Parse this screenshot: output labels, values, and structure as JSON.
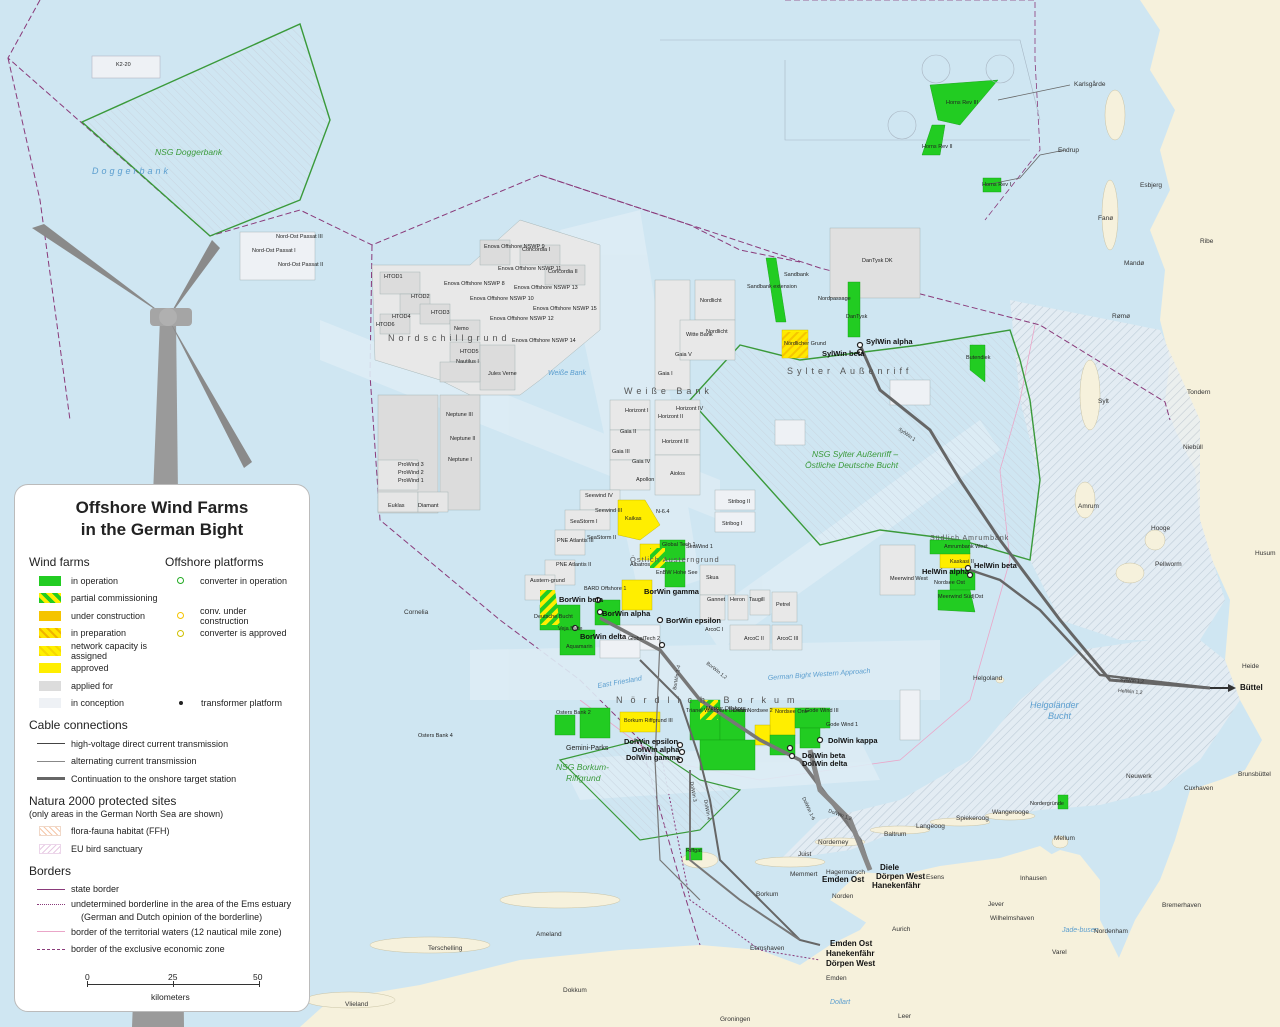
{
  "legend": {
    "title_line1": "Offshore Wind Farms",
    "title_line2": "in the German Bight",
    "wind_farms_heading": "Wind farms",
    "platforms_heading": "Offshore platforms",
    "farm_items": [
      {
        "label": "in operation",
        "color": "#22cc22"
      },
      {
        "label": "partial commissioning",
        "color": "#88cc22"
      },
      {
        "label": "under construction",
        "color": "#f5c400"
      },
      {
        "label": "in preparation",
        "color": "#f5d000"
      },
      {
        "label": "network capacity is assigned",
        "color": "#fff000"
      },
      {
        "label": "approved",
        "color": "#ffee00"
      },
      {
        "label": "applied for",
        "color": "#dcdcdc"
      },
      {
        "label": "in conception",
        "color": "#eef1f5"
      }
    ],
    "platform_items": [
      {
        "label": "converter in operation",
        "color": "#22aa22"
      },
      {
        "label": "conv. under construction",
        "color": "#f5c400"
      },
      {
        "label": "converter is approved",
        "color": "#eedd00"
      },
      {
        "label": "transformer platform",
        "color": "#222222"
      }
    ],
    "cable_heading": "Cable connections",
    "cable_items": [
      {
        "label": "high-voltage direct current transmission"
      },
      {
        "label": "alternating current transmission"
      },
      {
        "label": "Continuation to the onshore target station"
      }
    ],
    "natura_heading": "Natura 2000 protected sites",
    "natura_note": "(only areas in the German North Sea are shown)",
    "natura_items": [
      {
        "label": "flora-fauna habitat (FFH)"
      },
      {
        "label": "EU bird sanctuary"
      }
    ],
    "borders_heading": "Borders",
    "border_items": [
      {
        "label": "state border"
      },
      {
        "label": "undetermined borderline in the area of the Ems estuary"
      },
      {
        "label": "(German and Dutch opinion of the borderline)"
      },
      {
        "label": "border of the territorial waters (12 nautical mile zone)"
      },
      {
        "label": "border of the exclusive economic zone"
      }
    ],
    "scale": {
      "ticks": [
        "0",
        "25",
        "50"
      ],
      "unit": "kilometers"
    }
  },
  "map": {
    "colors": {
      "sea": "#cfe6f2",
      "land": "#f6f1dc",
      "operation": "#22cc22",
      "approved": "#ffee00",
      "applied": "#dcdcdc",
      "nsg": "#3a9a3a",
      "eez": "#8a3a7a"
    },
    "areas": [
      {
        "id": "doggerbank-nsg",
        "text": "NSG Doggerbank"
      },
      {
        "id": "doggerbank",
        "text": "Doggerbank"
      },
      {
        "id": "nordschillgrund",
        "text": "Nordschillgrund"
      },
      {
        "id": "weisse-bank",
        "text": "Weiße Bank"
      },
      {
        "id": "weisse-bank-water",
        "text": "Weiße Bank"
      },
      {
        "id": "sylter-aussenriff",
        "text": "Sylter Außenriff"
      },
      {
        "id": "nsg-sylter-1",
        "text": "NSG Sylter Außenriff –"
      },
      {
        "id": "nsg-sylter-2",
        "text": "Östliche Deutsche Bucht"
      },
      {
        "id": "oestlich-austerngrund",
        "text": "Östlich Austerngrund"
      },
      {
        "id": "suedlich-amrumbank",
        "text": "Südlich Amrumbank"
      },
      {
        "id": "noerdlich-borkum",
        "text": "Nördlich Borkum"
      },
      {
        "id": "nsg-borkum-1",
        "text": "NSG Borkum-"
      },
      {
        "id": "nsg-borkum-2",
        "text": "Riffgrund"
      },
      {
        "id": "helgolaender-bucht-1",
        "text": "Helgoländer"
      },
      {
        "id": "helgolaender-bucht-2",
        "text": "Bucht"
      },
      {
        "id": "german-bight-western-approach",
        "text": "German Bight Western Approach"
      },
      {
        "id": "east-friesland",
        "text": "East Friesland"
      },
      {
        "id": "jadebusen",
        "text": "Jade-busen"
      }
    ],
    "farms_small": [
      {
        "id": "k2-20",
        "text": "K2-20"
      },
      {
        "id": "nordost-passat-3",
        "text": "Nord-Ost Passat III"
      },
      {
        "id": "nordost-passat-1",
        "text": "Nord-Ost Passat I"
      },
      {
        "id": "nordost-passat-2",
        "text": "Nord-Ost Passat II"
      },
      {
        "id": "htod1",
        "text": "HTOD1"
      },
      {
        "id": "htod2",
        "text": "HTOD2"
      },
      {
        "id": "htod3",
        "text": "HTOD3"
      },
      {
        "id": "htod4",
        "text": "HTOD4"
      },
      {
        "id": "htod5",
        "text": "HTOD5"
      },
      {
        "id": "htod6",
        "text": "HTOD6"
      },
      {
        "id": "nautilus-1",
        "text": "Nautilus I"
      },
      {
        "id": "jules-verne",
        "text": "Jules Verne"
      },
      {
        "id": "nemo",
        "text": "Nemo"
      },
      {
        "id": "concordia-1",
        "text": "Concordia I"
      },
      {
        "id": "concordia-2",
        "text": "Concordia II"
      },
      {
        "id": "enova-9",
        "text": "Enova Offshore NSWP 9"
      },
      {
        "id": "enova-8",
        "text": "Enova Offshore NSWP 8"
      },
      {
        "id": "enova-10",
        "text": "Enova Offshore NSWP 10"
      },
      {
        "id": "enova-11",
        "text": "Enova Offshore NSWP 11"
      },
      {
        "id": "enova-12",
        "text": "Enova Offshore NSWP 12"
      },
      {
        "id": "enova-13",
        "text": "Enova Offshore NSWP 13"
      },
      {
        "id": "enova-14",
        "text": "Enova Offshore NSWP 14"
      },
      {
        "id": "enova-15",
        "text": "Enova Offshore NSWP 15"
      },
      {
        "id": "neptune-3",
        "text": "Neptune III"
      },
      {
        "id": "neptune-2",
        "text": "Neptune II"
      },
      {
        "id": "neptune-1",
        "text": "Neptune I"
      },
      {
        "id": "prowind-3",
        "text": "ProWind 3"
      },
      {
        "id": "prowind-2",
        "text": "ProWind 2"
      },
      {
        "id": "prowind-1",
        "text": "ProWind 1"
      },
      {
        "id": "euklas",
        "text": "Euklas"
      },
      {
        "id": "diamant",
        "text": "Diamant"
      },
      {
        "id": "nordlicht",
        "text": "Nordlicht"
      },
      {
        "id": "nordlicht2",
        "text": "Nordlicht"
      },
      {
        "id": "witte-bank",
        "text": "Witte Bank"
      },
      {
        "id": "gaia-5",
        "text": "Gaia V"
      },
      {
        "id": "gaia-1",
        "text": "Gaia I"
      },
      {
        "id": "horizont-1",
        "text": "Horizont I"
      },
      {
        "id": "horizont-4",
        "text": "Horizont IV"
      },
      {
        "id": "horizont-2",
        "text": "Horizont II"
      },
      {
        "id": "horizont-3",
        "text": "Horizont III"
      },
      {
        "id": "gaia-2",
        "text": "Gaia II"
      },
      {
        "id": "gaia-3",
        "text": "Gaia III"
      },
      {
        "id": "gaia-4",
        "text": "Gaia IV"
      },
      {
        "id": "apollon",
        "text": "Apollon"
      },
      {
        "id": "aiolos",
        "text": "Aiolos"
      },
      {
        "id": "seewind-4",
        "text": "Seewind IV"
      },
      {
        "id": "seewind-3",
        "text": "Seewind III"
      },
      {
        "id": "seastorm-1",
        "text": "SeaStorm I"
      },
      {
        "id": "seastorm-2",
        "text": "SeaStorm II"
      },
      {
        "id": "pne-3",
        "text": "PNE Atlantis III"
      },
      {
        "id": "pne-2",
        "text": "PNE Atlantis II"
      },
      {
        "id": "austerngrund",
        "text": "Austern-grund"
      },
      {
        "id": "kaikas",
        "text": "Kaikas"
      },
      {
        "id": "n64",
        "text": "N-6.4"
      },
      {
        "id": "stribog-2",
        "text": "Stribog II"
      },
      {
        "id": "stribog-1",
        "text": "Stribog I"
      },
      {
        "id": "skua",
        "text": "Skua"
      },
      {
        "id": "gannet",
        "text": "Gannet"
      },
      {
        "id": "heron",
        "text": "Heron"
      },
      {
        "id": "tausgill",
        "text": "Taugill"
      },
      {
        "id": "petrel",
        "text": "Petrel"
      },
      {
        "id": "arcoc1",
        "text": "ArcoC I"
      },
      {
        "id": "arcoc2",
        "text": "ArcoC II"
      },
      {
        "id": "arcoc3",
        "text": "ArcoC III"
      },
      {
        "id": "sandbank",
        "text": "Sandbank"
      },
      {
        "id": "sandbank-ext",
        "text": "Sandbank extension"
      },
      {
        "id": "nordpassage",
        "text": "Nordpassage"
      },
      {
        "id": "dantysk",
        "text": "DanTysk"
      },
      {
        "id": "dantysk-dk",
        "text": "DanTysk DK"
      },
      {
        "id": "noerdlicher-grund",
        "text": "Nördlicher Grund"
      },
      {
        "id": "butendiek",
        "text": "Butendiek"
      },
      {
        "id": "horns-rev-3",
        "text": "Horns Rev III"
      },
      {
        "id": "horns-rev-2",
        "text": "Horns Rev II"
      },
      {
        "id": "horns-rev-1",
        "text": "Horns Rev I"
      },
      {
        "id": "amrumbank-west",
        "text": "Amrumbank West"
      },
      {
        "id": "kaskasi",
        "text": "Kaskasi II"
      },
      {
        "id": "nordsee-ost",
        "text": "Nordsee Ost"
      },
      {
        "id": "meerwind",
        "text": "Meerwind Süd|Ost"
      },
      {
        "id": "meerwind-west",
        "text": "Meerwind West"
      },
      {
        "id": "deutsche-bucht",
        "text": "Deutsche Bucht"
      },
      {
        "id": "veja-mate",
        "text": "Veja Mate"
      },
      {
        "id": "bard",
        "text": "BARD Offshore 1"
      },
      {
        "id": "global-tech-1",
        "text": "Global Tech 1"
      },
      {
        "id": "seawind-1",
        "text": "SeaWind 1"
      },
      {
        "id": "albatros",
        "text": "Albatros"
      },
      {
        "id": "enbw-hohe-see",
        "text": "EnBW Hohe See"
      },
      {
        "id": "aquamarin",
        "text": "Aquamarin"
      },
      {
        "id": "globaltech-2",
        "text": "GlobalTech 2"
      },
      {
        "id": "borkum-riffgrund-3",
        "text": "Borkum Riffgrund III"
      },
      {
        "id": "trianel",
        "text": "Trianel Windpark Borkum"
      },
      {
        "id": "merkur",
        "text": "Merkur Offshore"
      },
      {
        "id": "delta-nordsee",
        "text": "Delta Nordsee 2"
      },
      {
        "id": "gode-wind-3",
        "text": "Gode Wind III"
      },
      {
        "id": "nordsee-one",
        "text": "Nordsee One"
      },
      {
        "id": "gode-wind-1",
        "text": "Gode Wind 1"
      },
      {
        "id": "riffgat",
        "text": "Riffgat"
      },
      {
        "id": "gemini",
        "text": "Gemini-Parks"
      },
      {
        "id": "nordergruende",
        "text": "Nordergründe"
      },
      {
        "id": "osters-bank-2",
        "text": "Osters Bank 2"
      },
      {
        "id": "osters-bank-4",
        "text": "Osters Bank 4"
      }
    ],
    "platforms": [
      {
        "id": "sylwin-alpha",
        "text": "SylWin alpha"
      },
      {
        "id": "sylwin-beta",
        "text": "SylWin beta"
      },
      {
        "id": "helwin-alpha",
        "text": "HelWin alpha"
      },
      {
        "id": "helwin-beta",
        "text": "HelWin beta"
      },
      {
        "id": "borwin-beta",
        "text": "BorWin beta"
      },
      {
        "id": "borwin-alpha",
        "text": "BorWin alpha"
      },
      {
        "id": "borwin-gamma",
        "text": "BorWin gamma"
      },
      {
        "id": "borwin-delta",
        "text": "BorWin delta"
      },
      {
        "id": "borwin-epsilon",
        "text": "BorWin epsilon"
      },
      {
        "id": "dolwin-epsilon",
        "text": "DolWin epsilon"
      },
      {
        "id": "dolwin-alpha",
        "text": "DolWin alpha"
      },
      {
        "id": "dolwin-gamma",
        "text": "DolWin gamma"
      },
      {
        "id": "dolwin-kappa",
        "text": "DolWin kappa"
      },
      {
        "id": "dolwin-beta",
        "text": "DolWin beta"
      },
      {
        "id": "dolwin-delta",
        "text": "DolWin delta"
      }
    ],
    "stations": [
      {
        "id": "buettel",
        "text": "Büttel"
      },
      {
        "id": "diele",
        "text": "Diele"
      },
      {
        "id": "doerpen-west",
        "text": "Dörpen West"
      },
      {
        "id": "hanekenfaehr",
        "text": "Hanekenfähr"
      },
      {
        "id": "emden-ost",
        "text": "Emden Ost"
      },
      {
        "id": "emden-ost-2",
        "text": "Emden Ost"
      },
      {
        "id": "hanekenfaehr-2",
        "text": "Hanekenfähr"
      },
      {
        "id": "doerpen-west-2",
        "text": "Dörpen West"
      }
    ],
    "towns": [
      {
        "id": "karlsgaarde",
        "text": "Karlsgårde"
      },
      {
        "id": "esbjerg",
        "text": "Esbjerg"
      },
      {
        "id": "ribe",
        "text": "Ribe"
      },
      {
        "id": "endrup",
        "text": "Endrup"
      },
      {
        "id": "tondern",
        "text": "Tondern"
      },
      {
        "id": "sylt",
        "text": "Sylt"
      },
      {
        "id": "niebuell",
        "text": "Niebüll"
      },
      {
        "id": "amrum",
        "text": "Amrum"
      },
      {
        "id": "husum",
        "text": "Husum"
      },
      {
        "id": "pellworm",
        "text": "Pellworm"
      },
      {
        "id": "heide",
        "text": "Heide"
      },
      {
        "id": "brunsbuettel",
        "text": "Brunsbüttel"
      },
      {
        "id": "cuxhaven",
        "text": "Cuxhaven"
      },
      {
        "id": "helgoland",
        "text": "Helgoland"
      },
      {
        "id": "neuwerk",
        "text": "Neuwerk"
      },
      {
        "id": "bremerhaven",
        "text": "Bremerhaven"
      },
      {
        "id": "nordenham",
        "text": "Nordenham"
      },
      {
        "id": "wilhelmshaven",
        "text": "Wilhelmshaven"
      },
      {
        "id": "jever",
        "text": "Jever"
      },
      {
        "id": "inhausen",
        "text": "Inhausen"
      },
      {
        "id": "esens",
        "text": "Esens"
      },
      {
        "id": "aurich",
        "text": "Aurich"
      },
      {
        "id": "norden",
        "text": "Norden"
      },
      {
        "id": "hagermarsch",
        "text": "Hagermarsch"
      },
      {
        "id": "emden",
        "text": "Emden"
      },
      {
        "id": "eemshaven",
        "text": "Eemshaven"
      },
      {
        "id": "groningen",
        "text": "Groningen"
      },
      {
        "id": "dokkum",
        "text": "Dokkum"
      },
      {
        "id": "vlieland",
        "text": "Vlieland"
      },
      {
        "id": "terschelling",
        "text": "Terschelling"
      },
      {
        "id": "ameland",
        "text": "Ameland"
      },
      {
        "id": "borkum",
        "text": "Borkum"
      },
      {
        "id": "juist",
        "text": "Juist"
      },
      {
        "id": "baltrum",
        "text": "Baltrum"
      },
      {
        "id": "langeoog",
        "text": "Langeoog"
      },
      {
        "id": "spiekeroog",
        "text": "Spiekeroog"
      },
      {
        "id": "wangerooge",
        "text": "Wangerooge"
      },
      {
        "id": "norderney",
        "text": "Norderney"
      },
      {
        "id": "memmert",
        "text": "Memmert"
      },
      {
        "id": "varel",
        "text": "Varel"
      },
      {
        "id": "leer",
        "text": "Leer"
      },
      {
        "id": "mellum",
        "text": "Mellum"
      },
      {
        "id": "fanoe",
        "text": "Fanø"
      },
      {
        "id": "manoe",
        "text": "Mandø"
      },
      {
        "id": "roemoe",
        "text": "Rømø"
      },
      {
        "id": "hooge",
        "text": "Hooge"
      },
      {
        "id": "dollart",
        "text": "Dollart"
      },
      {
        "id": "cornelia",
        "text": "Cornelia"
      }
    ],
    "cables": [
      {
        "id": "sylwin-1",
        "text": "SylWin 1"
      },
      {
        "id": "sylwin-12",
        "text": "SylWin 1,2"
      },
      {
        "id": "helwin-12",
        "text": "HelWin 1,2"
      },
      {
        "id": "borwin-12",
        "text": "BorWin 1,2"
      },
      {
        "id": "borwin-14",
        "text": "BorWin 1-4"
      },
      {
        "id": "dolwin-16",
        "text": "DolWin 1-6"
      },
      {
        "id": "dolwin-12",
        "text": "DolWin 1,2"
      },
      {
        "id": "dolwin-3",
        "text": "DolWin 3"
      },
      {
        "id": "dolwin-4",
        "text": "DolWin 4"
      }
    ]
  }
}
